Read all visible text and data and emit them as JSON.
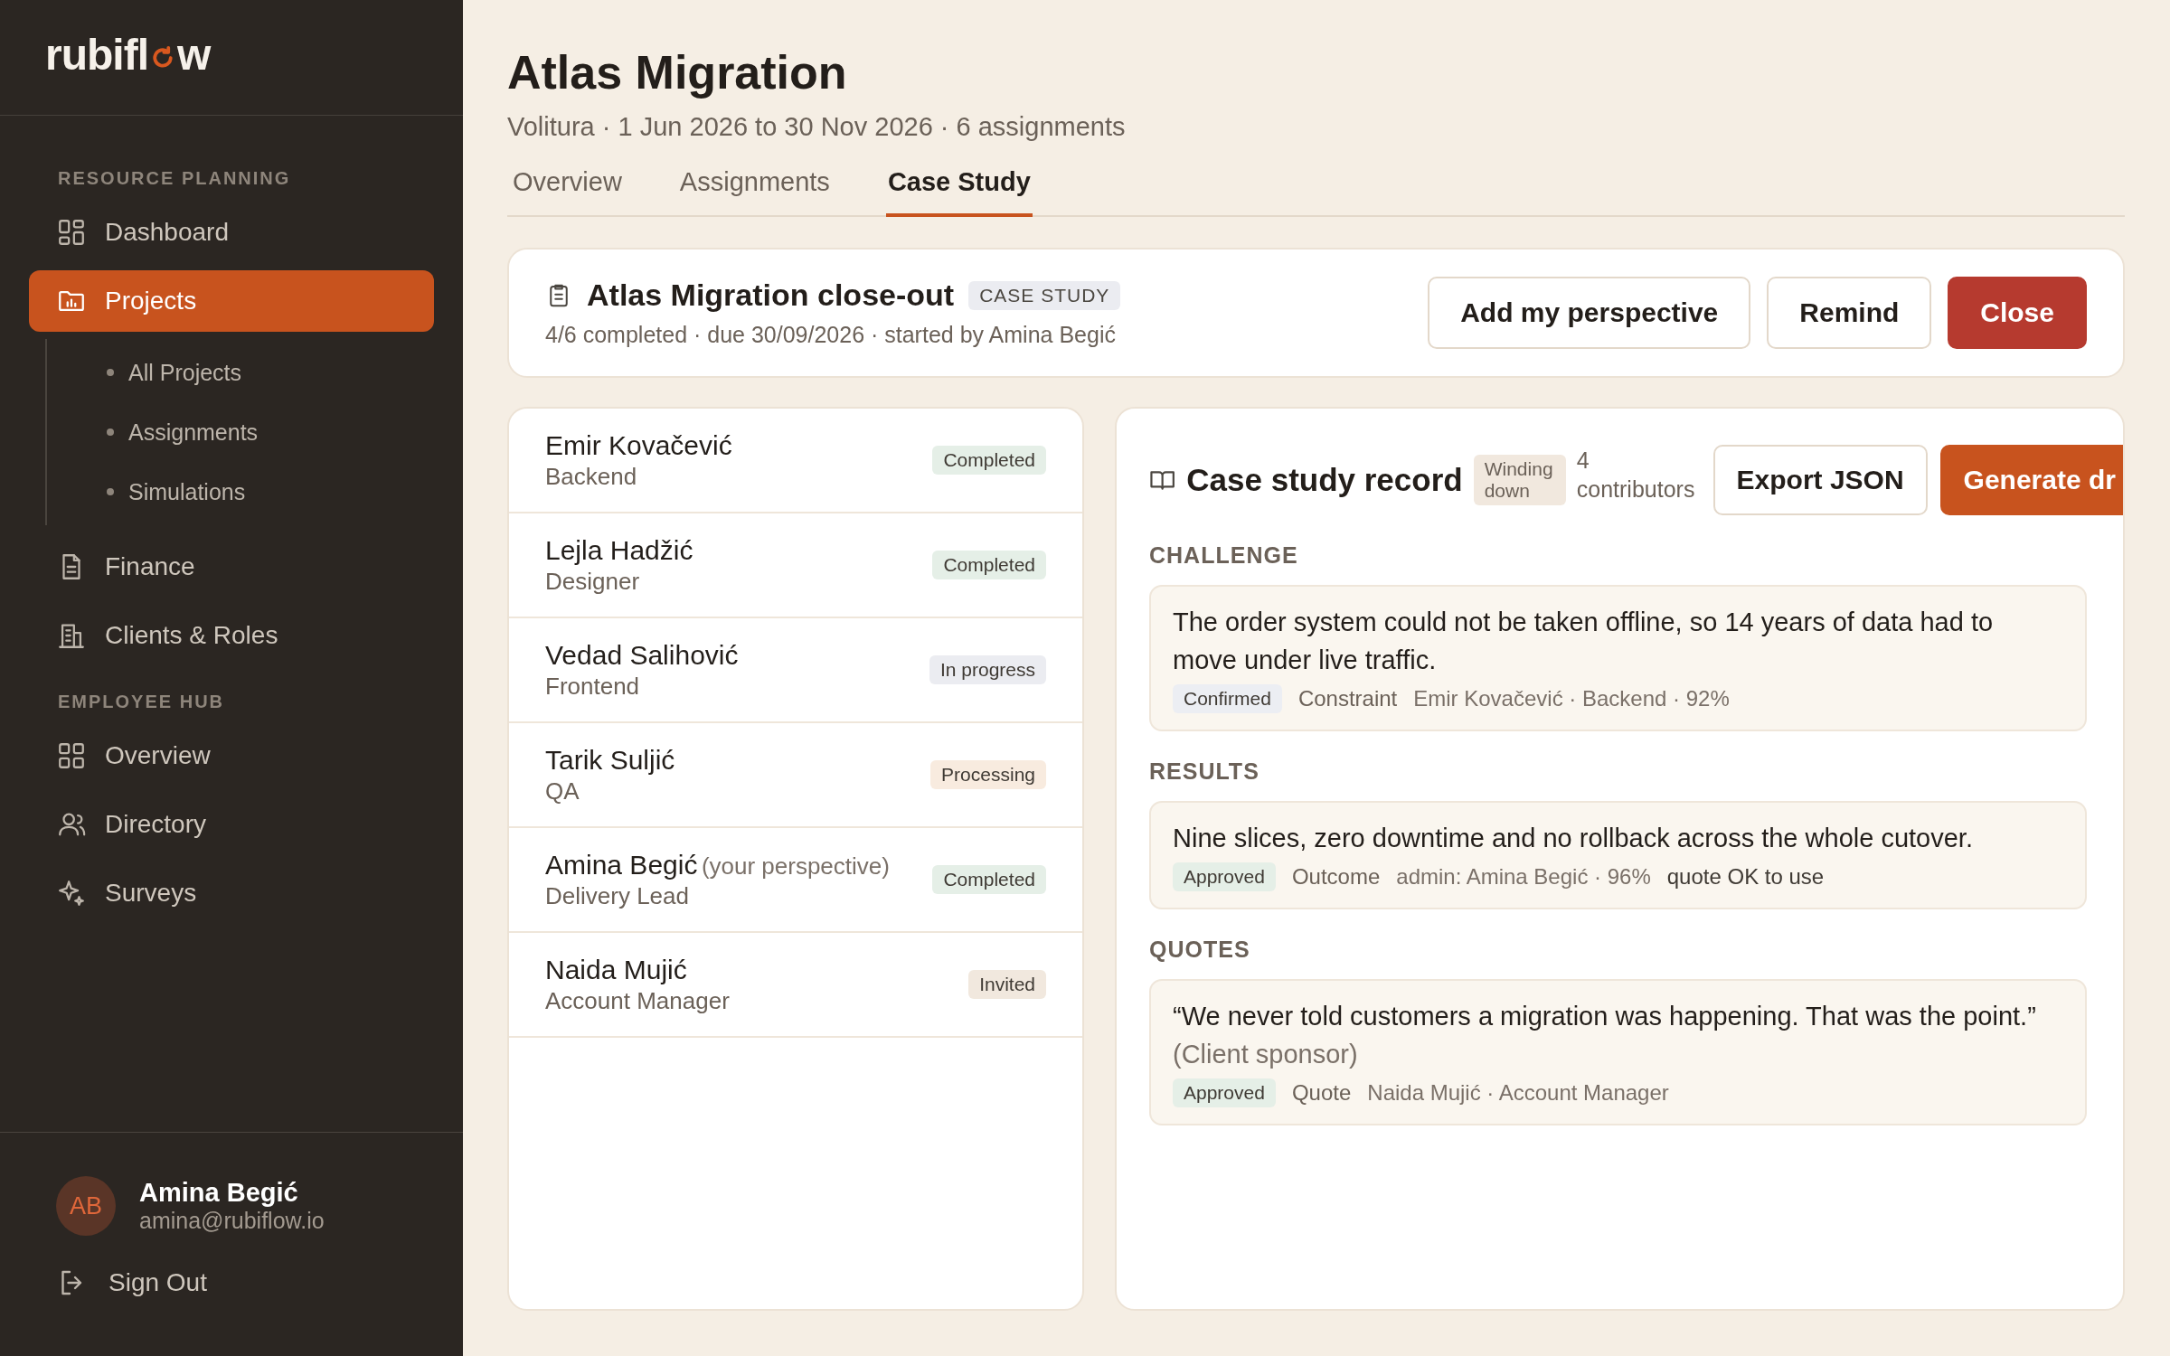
{
  "sidebar": {
    "logo": {
      "before": "rubifl",
      "after": "w"
    },
    "sections": [
      {
        "title": "RESOURCE PLANNING",
        "items": [
          {
            "label": "Dashboard",
            "selected": false
          },
          {
            "label": "Projects",
            "selected": true,
            "children": [
              {
                "label": "All Projects"
              },
              {
                "label": "Assignments"
              },
              {
                "label": "Simulations"
              }
            ]
          },
          {
            "label": "Finance",
            "selected": false
          },
          {
            "label": "Clients & Roles",
            "selected": false
          }
        ]
      },
      {
        "title": "EMPLOYEE HUB",
        "items": [
          {
            "label": "Overview",
            "selected": false
          },
          {
            "label": "Directory",
            "selected": false
          },
          {
            "label": "Surveys",
            "selected": false
          }
        ]
      }
    ],
    "user": {
      "initials": "AB",
      "name": "Amina Begić",
      "email": "amina@rubiflow.io"
    },
    "sign_out": "Sign Out"
  },
  "header": {
    "title": "Atlas Migration",
    "subtitle": "Volitura · 1 Jun 2026 to 30 Nov 2026 · 6 assignments"
  },
  "tabs": [
    {
      "label": "Overview",
      "selected": false
    },
    {
      "label": "Assignments",
      "selected": false
    },
    {
      "label": "Case Study",
      "selected": true
    }
  ],
  "case_study": {
    "title": "Atlas Migration close-out",
    "badge": "CASE STUDY",
    "meta": "4/6 completed · due 30/09/2026 · started by Amina Begić",
    "buttons": [
      {
        "label": "Add my perspective",
        "kind": "secondary"
      },
      {
        "label": "Remind",
        "kind": "secondary"
      },
      {
        "label": "Close",
        "kind": "danger"
      }
    ]
  },
  "participants": [
    {
      "name": "Emir Kovačević",
      "role": "Backend",
      "status": "Completed",
      "color": "#e5efe7"
    },
    {
      "name": "Lejla Hadžić",
      "role": "Designer",
      "status": "Completed",
      "color": "#e5efe7"
    },
    {
      "name": "Vedad Salihović",
      "role": "Frontend",
      "status": "In progress",
      "color": "#ebecf1"
    },
    {
      "name": "Tarik Suljić",
      "role": "QA",
      "status": "Processing",
      "color": "#f8ebdf"
    },
    {
      "name": "Amina Begić",
      "note": "(your perspective)",
      "role": "Delivery Lead",
      "status": "Completed",
      "color": "#e5efe7"
    },
    {
      "name": "Naida Mujić",
      "role": "Account Manager",
      "status": "Invited",
      "color": "#f1e8de"
    }
  ],
  "record": {
    "title": "Case study record",
    "stage": "Winding down",
    "contributors": "4 contributors",
    "buttons": [
      {
        "label": "Export JSON",
        "kind": "secondary"
      },
      {
        "label": "Generate dr",
        "kind": "primary"
      }
    ],
    "sections": [
      {
        "heading": "CHALLENGE",
        "entries": [
          {
            "text": "The order system could not be taken offline, so 14 years of data had to move under live traffic.",
            "tag": "Confirmed",
            "color": "#eceef3",
            "type": "Constraint",
            "source": "Emir Kovačević · Backend · 92%"
          }
        ]
      },
      {
        "heading": "RESULTS",
        "entries": [
          {
            "text": "Nine slices, zero downtime and no rollback across the whole cutover.",
            "tag": "Approved",
            "color": "#e5efe7",
            "type": "Outcome",
            "source": "admin: Amina Begić · 96%",
            "extra": "quote OK to use"
          }
        ]
      },
      {
        "heading": "QUOTES",
        "entries": [
          {
            "text": "“We never told customers a migration was happening. That was the point.”",
            "attribution": "(Client sponsor)",
            "tag": "Approved",
            "color": "#e5efe7",
            "type": "Quote",
            "source": "Naida Mujić · Account Manager"
          }
        ]
      }
    ]
  }
}
